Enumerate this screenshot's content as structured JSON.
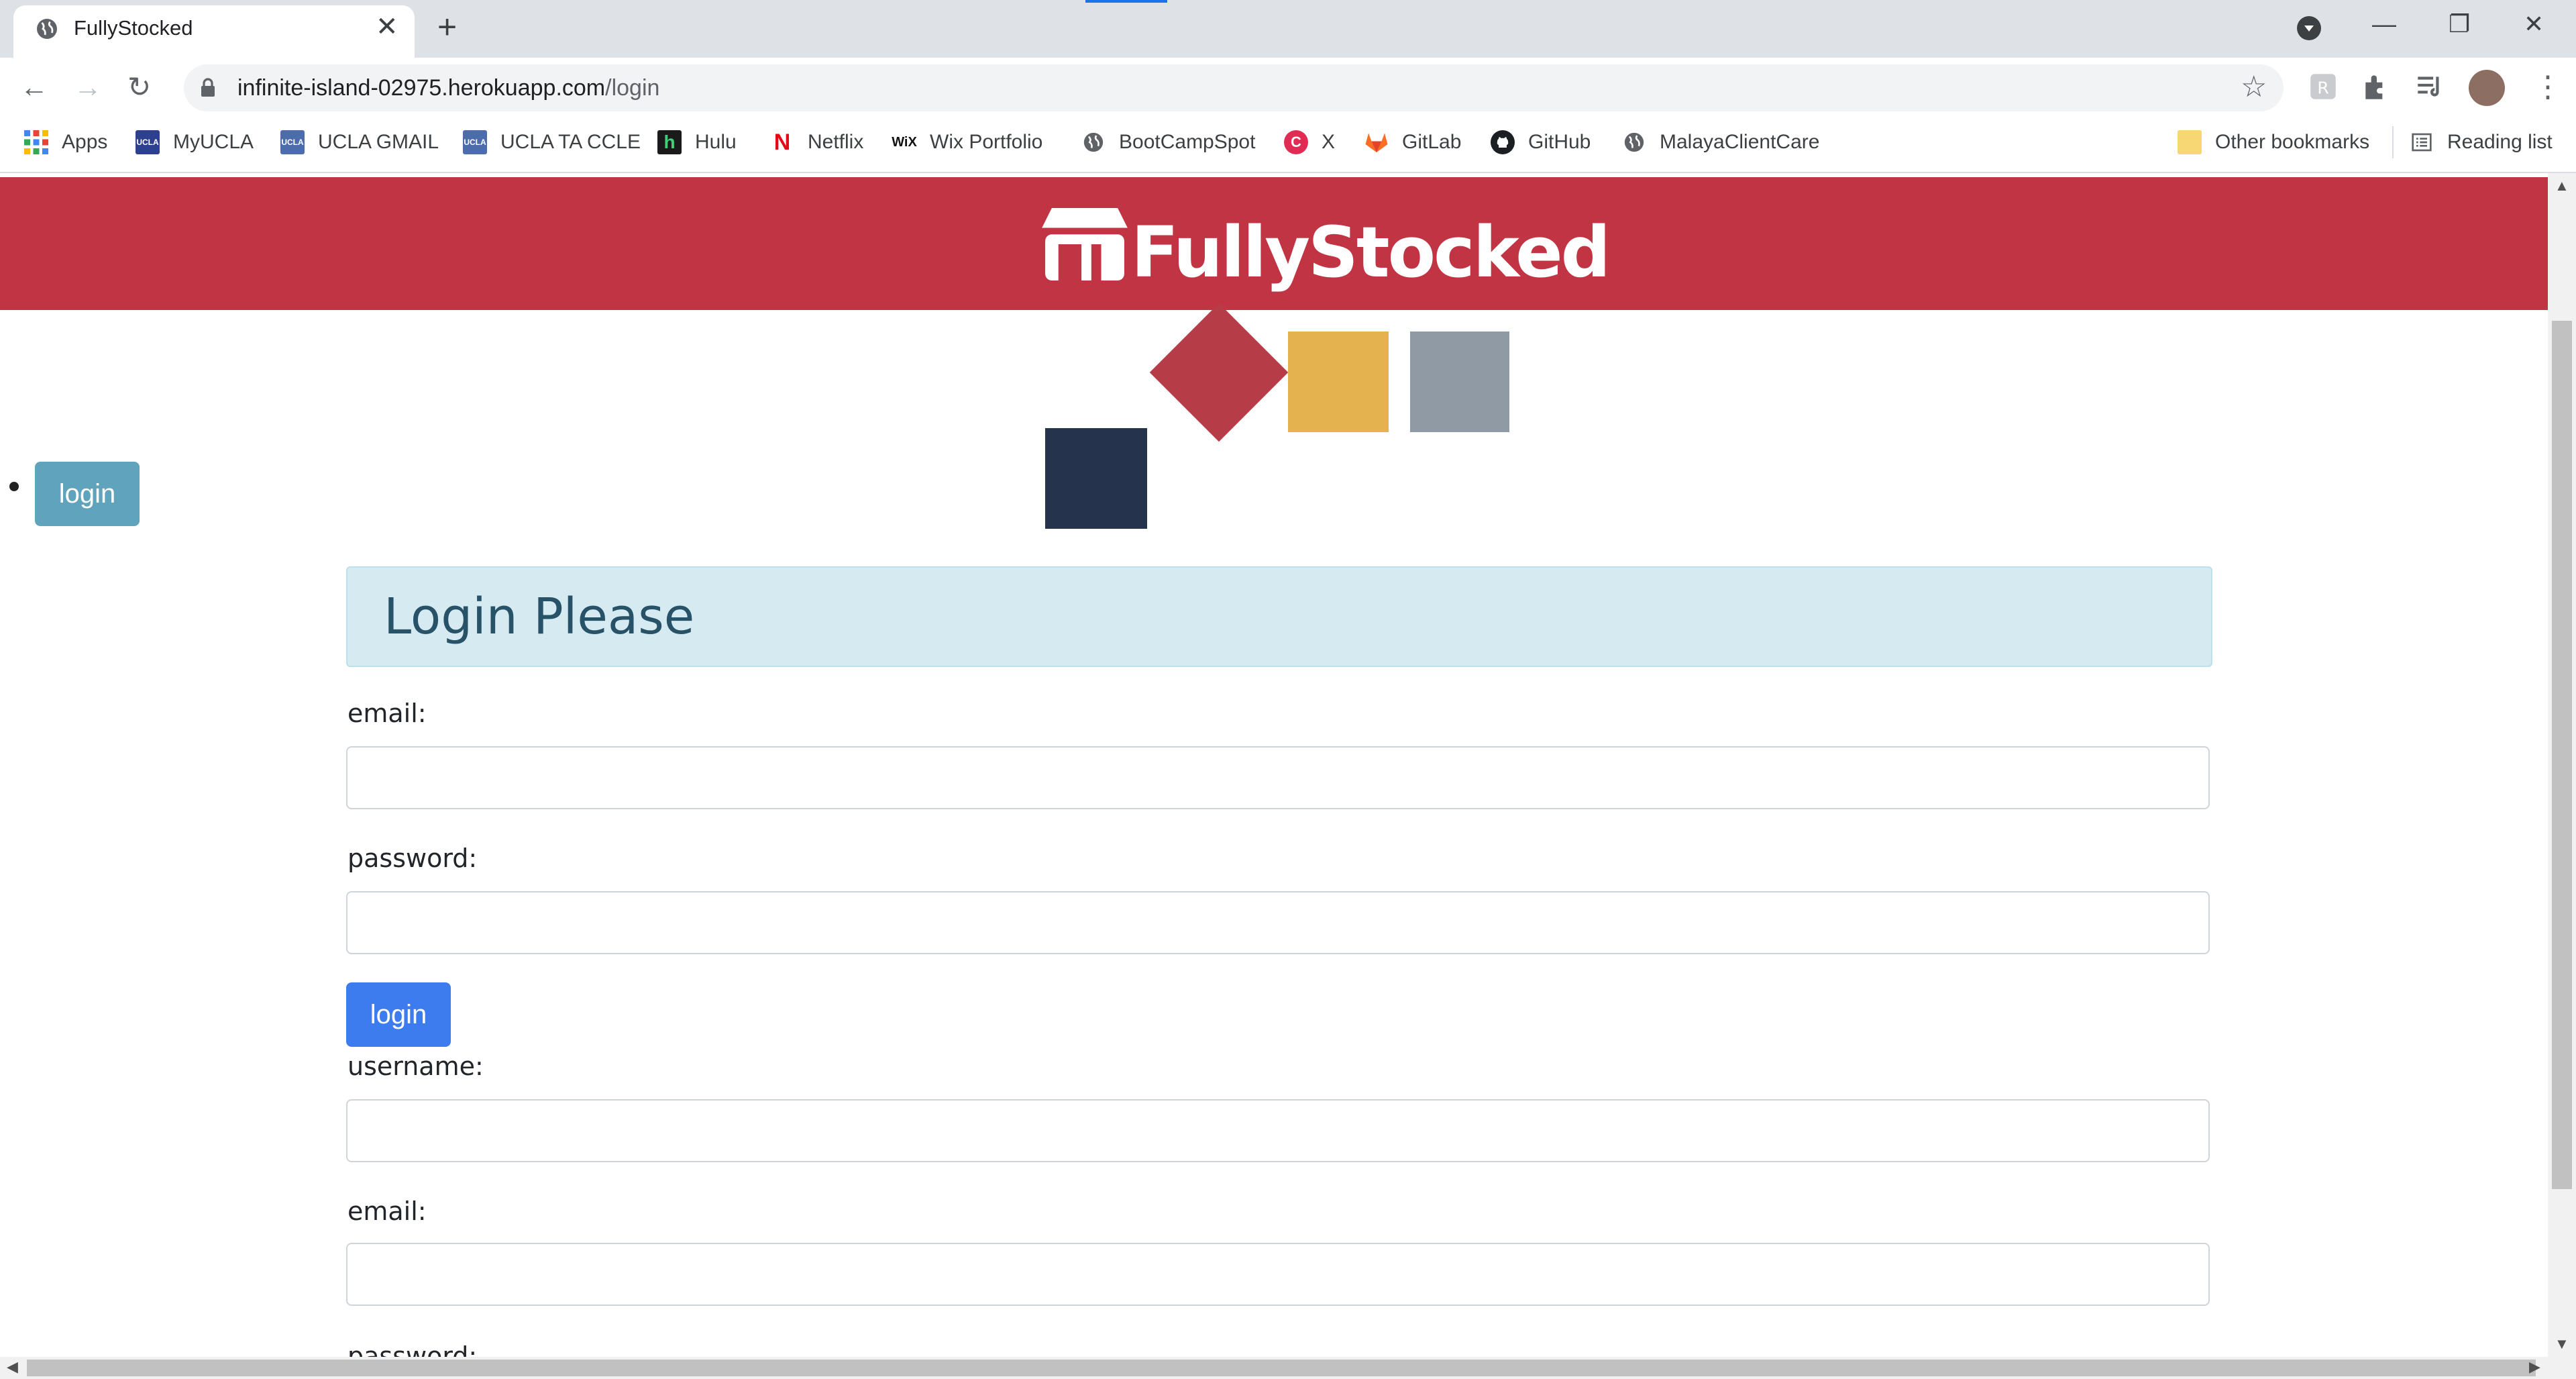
{
  "browser": {
    "tab_title": "FullyStocked",
    "url_host": "infinite-island-02975.herokuapp.com",
    "url_path": "/login",
    "bookmarks": [
      {
        "label": "Apps",
        "icon": "apps-grid-icon"
      },
      {
        "label": "MyUCLA",
        "icon": "ucla-icon"
      },
      {
        "label": "UCLA GMAIL",
        "icon": "ucla-icon"
      },
      {
        "label": "UCLA TA CCLE",
        "icon": "ucla-icon"
      },
      {
        "label": "Hulu",
        "icon": "hulu-icon"
      },
      {
        "label": "Netflix",
        "icon": "netflix-icon"
      },
      {
        "label": "Wix Portfolio",
        "icon": "wix-icon"
      },
      {
        "label": "BootCampSpot",
        "icon": "globe-icon"
      },
      {
        "label": "X",
        "icon": "x-app-icon"
      },
      {
        "label": "GitLab",
        "icon": "gitlab-icon"
      },
      {
        "label": "GitHub",
        "icon": "github-icon"
      },
      {
        "label": "MalayaClientCare",
        "icon": "globe-icon"
      }
    ],
    "other_bookmarks": "Other bookmarks",
    "reading_list": "Reading list"
  },
  "brand": {
    "name": "FullyStocked",
    "color": "#c13444"
  },
  "nav": {
    "login_label": "login"
  },
  "login": {
    "title": "Login Please",
    "email_label": "email:",
    "password_label": "password:",
    "submit_label": "login"
  },
  "signup": {
    "username_label": "username:",
    "email_label": "email:",
    "password_label": "password:"
  }
}
